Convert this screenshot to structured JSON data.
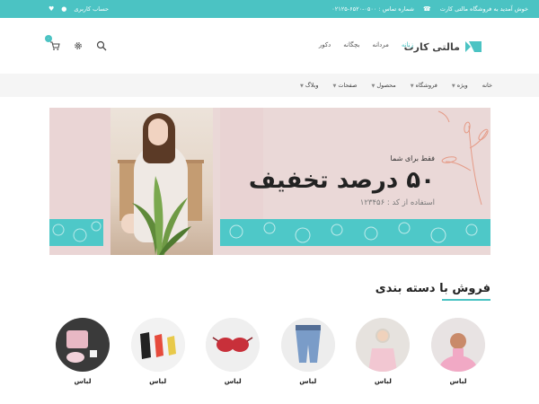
{
  "topbar": {
    "welcome": "خوش آمدید به فروشگاه مالتی کارت",
    "phone": "شماره تماس : ۰۵۰۰-۶۵۲۰-۰۲۱۲۵",
    "account": "حساب کاربری",
    "bg_color": "#4bc3c3"
  },
  "header": {
    "logo_text": "مالتی کارت",
    "nav": [
      {
        "label": "زنانه",
        "active": true
      },
      {
        "label": "مردانه",
        "active": false
      },
      {
        "label": "بچگانه",
        "active": false
      },
      {
        "label": "دکور",
        "active": false
      }
    ],
    "cart_count": "۰",
    "icons": [
      "cart-icon",
      "settings-icon",
      "search-icon"
    ]
  },
  "catnav": {
    "items": [
      "خانه",
      "ویژه",
      "فروشگاه",
      "محصول",
      "صفحات",
      "وبلاگ"
    ]
  },
  "banner": {
    "small": "فقط برای شما",
    "big": "۵۰ درصد تخفیف",
    "code": "استفاده از کد : ۱۲۳۴۵۶",
    "accent": "#4ec8c8",
    "bg": "#ead8d7"
  },
  "section": {
    "title": "فروش با دسته بندی"
  },
  "categories": [
    {
      "label": "لباس"
    },
    {
      "label": "لباس"
    },
    {
      "label": "لباس"
    },
    {
      "label": "لباس"
    },
    {
      "label": "لباس"
    },
    {
      "label": "لباس"
    }
  ]
}
